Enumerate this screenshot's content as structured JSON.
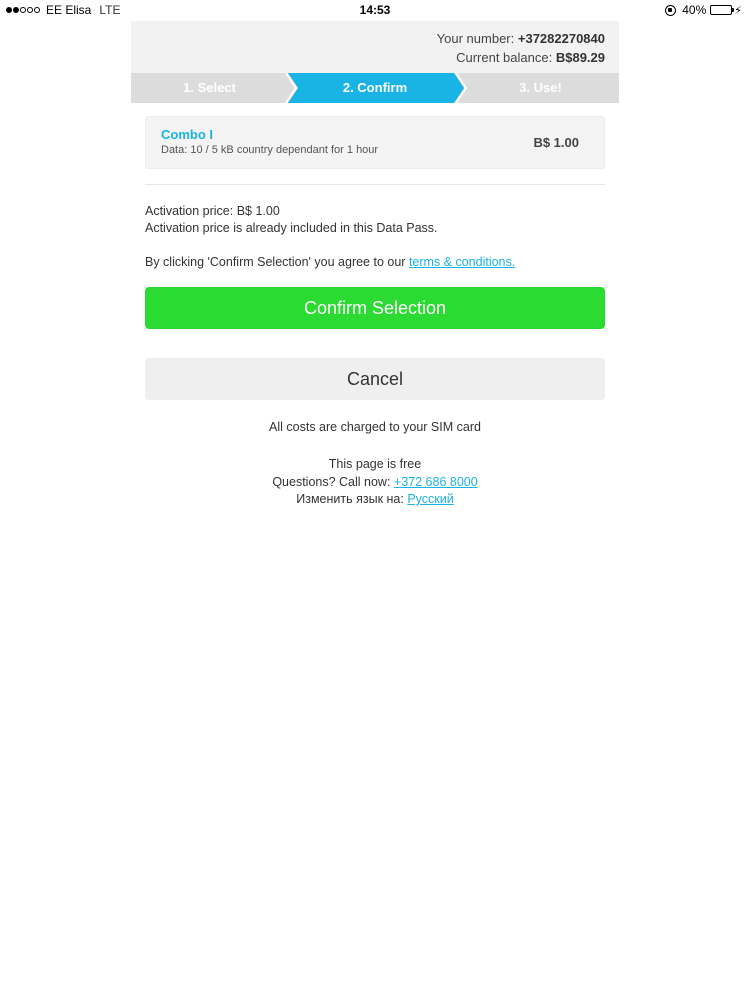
{
  "status_bar": {
    "carrier": "EE Elisa",
    "network": "LTE",
    "time": "14:53",
    "battery": "40%",
    "battery_level": 0.4
  },
  "account": {
    "number_label": "Your number:",
    "number": "+37282270840",
    "balance_label": "Current balance:",
    "balance": "B$89.29"
  },
  "steps": [
    {
      "label": "1. Select",
      "active": false
    },
    {
      "label": "2. Confirm",
      "active": true
    },
    {
      "label": "3. Use!",
      "active": false
    }
  ],
  "offer": {
    "name": "Combo I",
    "description": "Data: 10 / 5 kB  country dependant for 1 hour",
    "price": "B$ 1.00"
  },
  "info": {
    "activation_price": "Activation price: B$ 1.00",
    "included_note": "Activation price is already included in this Data Pass.",
    "agree_text": "By clicking 'Confirm Selection' you agree to our ",
    "terms_link": "terms & conditions."
  },
  "buttons": {
    "confirm": "Confirm Selection",
    "cancel": "Cancel"
  },
  "footer": {
    "costs_note": "All costs are charged to your SIM card",
    "free_note": "This page is free",
    "questions_label": "Questions? Call now: ",
    "phone": "+372 686 8000",
    "language_label": "Изменить язык на: ",
    "language_link": "Русский"
  },
  "colors": {
    "accent": "#1ab3e5",
    "confirm_button": "#2bdb32",
    "step_inactive": "#dcdcdc"
  }
}
